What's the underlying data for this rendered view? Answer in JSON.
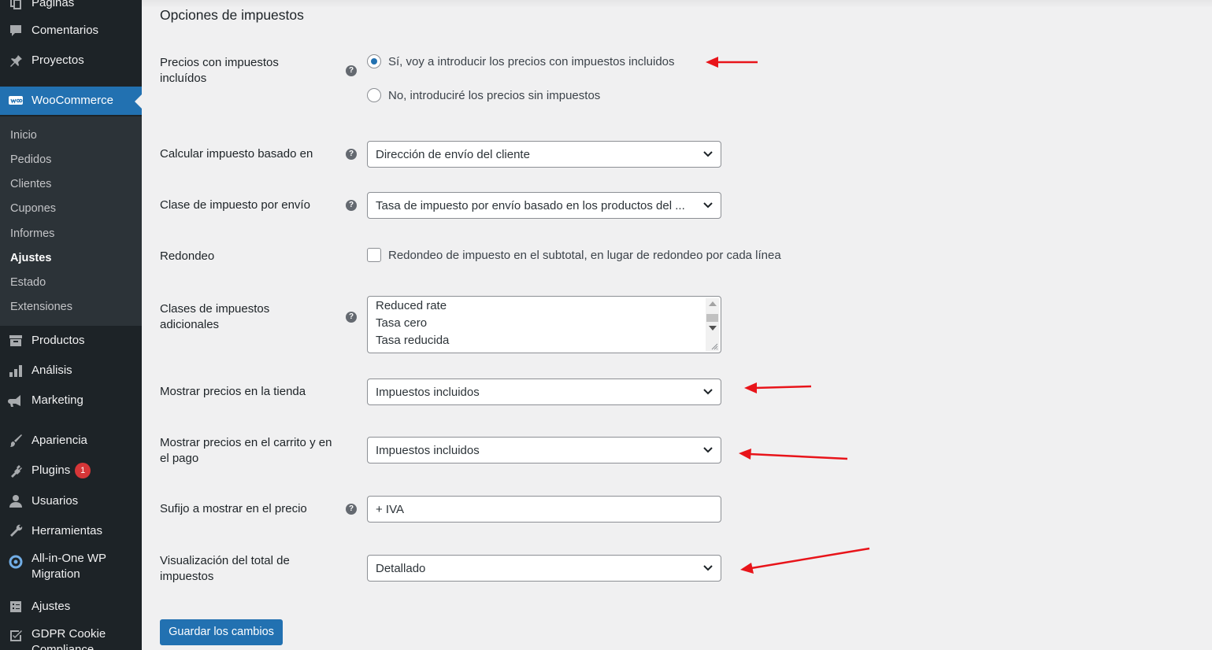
{
  "sidebar": {
    "top_items": [
      {
        "label": "Páginas",
        "icon": "pages-icon"
      },
      {
        "label": "Comentarios",
        "icon": "comments-icon"
      },
      {
        "label": "Proyectos",
        "icon": "pin-icon"
      }
    ],
    "woocommerce": {
      "label": "WooCommerce",
      "icon": "woo-icon"
    },
    "submenu": [
      "Inicio",
      "Pedidos",
      "Clientes",
      "Cupones",
      "Informes",
      "Ajustes",
      "Estado",
      "Extensiones"
    ],
    "submenu_active": "Ajustes",
    "bottom_items": [
      {
        "label": "Productos",
        "icon": "archive-icon"
      },
      {
        "label": "Análisis",
        "icon": "bar-chart-icon"
      },
      {
        "label": "Marketing",
        "icon": "megaphone-icon"
      },
      {
        "label": "Apariencia",
        "icon": "paintbrush-icon"
      },
      {
        "label": "Plugins",
        "icon": "plug-icon",
        "badge": "1"
      },
      {
        "label": "Usuarios",
        "icon": "user-icon"
      },
      {
        "label": "Herramientas",
        "icon": "wrench-icon"
      },
      {
        "label": "All-in-One WP Migration",
        "icon": "migration-icon"
      },
      {
        "label": "Ajustes",
        "icon": "settings-icon"
      },
      {
        "label": "GDPR Cookie Compliance",
        "icon": "check-shield-icon"
      }
    ]
  },
  "main": {
    "section_title": "Opciones de impuestos",
    "prices_entered": {
      "label": "Precios con impuestos incluídos",
      "options": [
        {
          "label": "Sí, voy a introducir los precios con impuestos incluidos",
          "checked": true
        },
        {
          "label": "No, introduciré los precios sin impuestos",
          "checked": false
        }
      ]
    },
    "calc_based_on": {
      "label": "Calcular impuesto basado en",
      "value": "Dirección de envío del cliente"
    },
    "shipping_tax_class": {
      "label": "Clase de impuesto por envío",
      "value": "Tasa de impuesto por envío basado en los productos del ..."
    },
    "rounding": {
      "label": "Redondeo",
      "checkbox_label": "Redondeo de impuesto en el subtotal, en lugar de redondeo por cada línea",
      "checked": false
    },
    "additional_classes": {
      "label": "Clases de impuestos adicionales",
      "values": [
        "Reduced rate",
        "Tasa cero",
        "Tasa reducida"
      ]
    },
    "display_shop": {
      "label": "Mostrar precios en la tienda",
      "value": "Impuestos incluidos"
    },
    "display_cart": {
      "label": "Mostrar precios en el carrito y en el pago",
      "value": "Impuestos incluidos"
    },
    "price_suffix": {
      "label": "Sufijo a mostrar en el precio",
      "value": "+ IVA"
    },
    "tax_total_display": {
      "label": "Visualización del total de impuestos",
      "value": "Detallado"
    },
    "save_button": "Guardar los cambios"
  },
  "colors": {
    "sidebar_bg": "#1d2327",
    "submenu_bg": "#2c3338",
    "accent": "#2271b1",
    "annotation_arrow": "#e8141a",
    "badge": "#d63638"
  }
}
